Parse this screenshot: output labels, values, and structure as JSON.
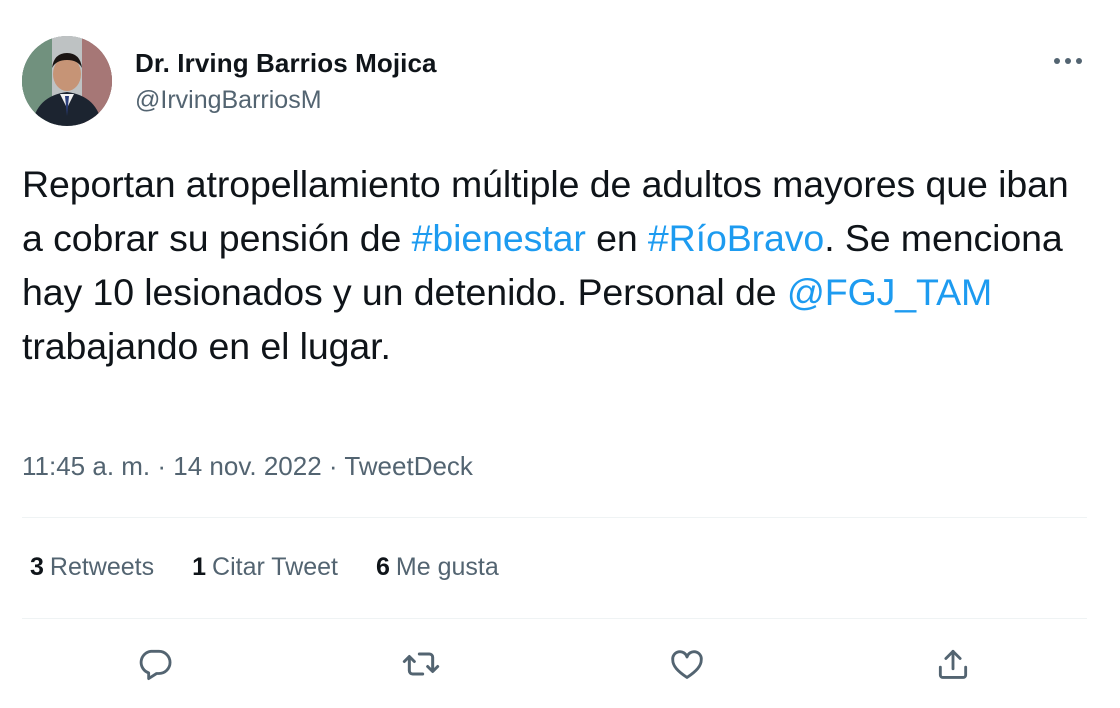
{
  "author": {
    "name": "Dr. Irving Barrios Mojica",
    "handle": "@IrvingBarriosM"
  },
  "tweet": {
    "text_1": "Reportan atropellamiento múltiple de adultos mayores que iban a cobrar su pensión de ",
    "hashtag_1": "#bienestar",
    "text_2": " en ",
    "hashtag_2": "#RíoBravo",
    "text_3": ". Se menciona hay 10 lesionados y un detenido. Personal de ",
    "mention_1": "@FGJ_TAM",
    "text_4": " trabajando en el lugar."
  },
  "meta": {
    "time": "11:45 a. m.",
    "separator": " · ",
    "date": "14 nov. 2022",
    "source": "TweetDeck"
  },
  "stats": [
    {
      "count": "3",
      "label": "Retweets"
    },
    {
      "count": "1",
      "label": "Citar Tweet"
    },
    {
      "count": "6",
      "label": "Me gusta"
    }
  ],
  "icons": {
    "more": "more-icon",
    "reply": "reply-icon",
    "retweet": "retweet-icon",
    "like": "like-icon",
    "share": "share-icon"
  },
  "colors": {
    "link": "#1d9bf0",
    "secondary_text": "#536471",
    "primary_text": "#0f1419",
    "divider": "#eff3f4"
  }
}
